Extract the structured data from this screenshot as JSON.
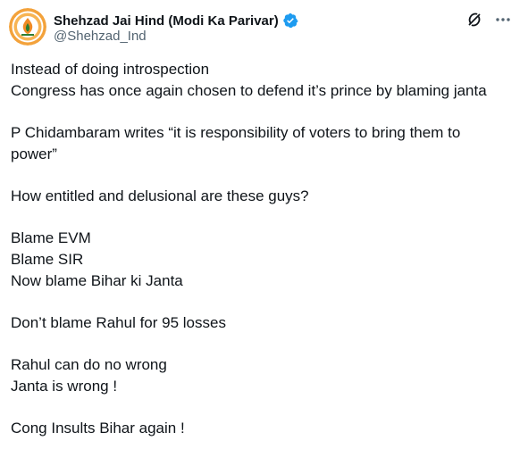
{
  "author": {
    "display_name": "Shehzad Jai Hind (Modi Ka Parivar)",
    "handle": "@Shehzad_Ind",
    "verified": true,
    "verified_color": "#1d9bf0"
  },
  "icons": {
    "verified": "verified-badge-icon",
    "grok": "grok-icon",
    "more": "more-options-icon"
  },
  "tweet": {
    "paragraphs": [
      [
        "Instead of doing introspection",
        "Congress has once again chosen to defend it’s prince by blaming janta"
      ],
      [
        "P Chidambaram writes “it is responsibility of voters to bring them to",
        "power”"
      ],
      [
        "How entitled and delusional are these guys?"
      ],
      [
        "Blame EVM",
        "Blame SIR",
        "Now blame Bihar ki Janta"
      ],
      [
        "Don’t blame Rahul for 95 losses"
      ],
      [
        "Rahul can do no wrong",
        "Janta is wrong !"
      ],
      [
        "Cong Insults Bihar again !"
      ]
    ]
  }
}
